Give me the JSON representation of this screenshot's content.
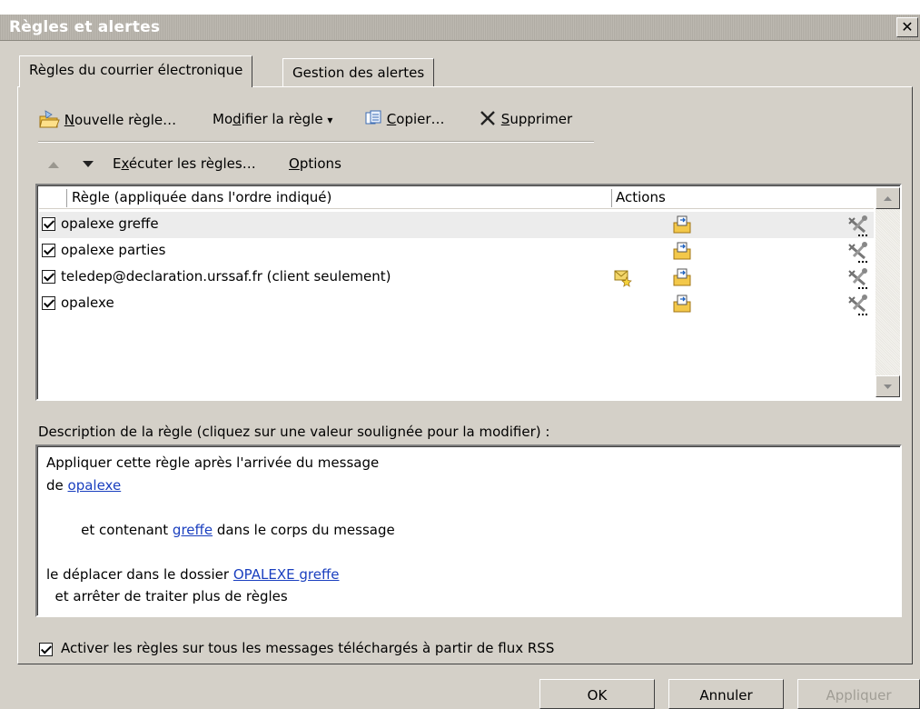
{
  "window": {
    "title": "Règles et alertes",
    "close_glyph": "✕"
  },
  "tabs": [
    {
      "label": "Règles du courrier électronique"
    },
    {
      "label": "Gestion des alertes"
    }
  ],
  "toolbar": {
    "new_rule": {
      "pre": "",
      "ul": "N",
      "post": "ouvelle règle…"
    },
    "modify_rule": {
      "pre": "Mo",
      "ul": "d",
      "post": "ifier la règle"
    },
    "modify_arrow": "▾",
    "copy": {
      "pre": "",
      "ul": "C",
      "post": "opier…"
    },
    "delete": {
      "pre": "",
      "ul": "S",
      "post": "upprimer"
    },
    "run_rules": {
      "pre": "E",
      "ul": "x",
      "post": "écuter les règles…"
    },
    "options": {
      "pre": "",
      "ul": "O",
      "post": "ptions"
    }
  },
  "rules_list": {
    "columns": [
      "Règle (appliquée dans l'ordre indiqué)",
      "Actions"
    ],
    "rows": [
      {
        "label": "opalexe greffe",
        "checked": true,
        "client_only_icon": false
      },
      {
        "label": "opalexe parties",
        "checked": true,
        "client_only_icon": false
      },
      {
        "label": "teledep@declaration.urssaf.fr  (client seulement)",
        "checked": true,
        "client_only_icon": true
      },
      {
        "label": "opalexe",
        "checked": true,
        "client_only_icon": false
      }
    ],
    "selected_index": 0
  },
  "description": {
    "label": "Description de la règle (cliquez sur une valeur soulignée pour la modifier) :",
    "line1": "Appliquer cette règle après l'arrivée du message",
    "line2_pre": "de ",
    "line2_link": "opalexe",
    "line3_pre": "  et contenant ",
    "line3_link": "greffe",
    "line3_post": " dans le corps du message",
    "line4_pre": "le déplacer dans le dossier ",
    "line4_link": "OPALEXE greffe",
    "line5": "  et arrêter de traiter plus de règles"
  },
  "rss_option": {
    "label": "Activer les règles sur tous les messages téléchargés à partir de flux RSS",
    "checked": true
  },
  "buttons": {
    "ok": "OK",
    "cancel": "Annuler",
    "apply": "Appliquer"
  },
  "colors": {
    "face": "#d4d0c8",
    "link": "#1a3fbf"
  }
}
